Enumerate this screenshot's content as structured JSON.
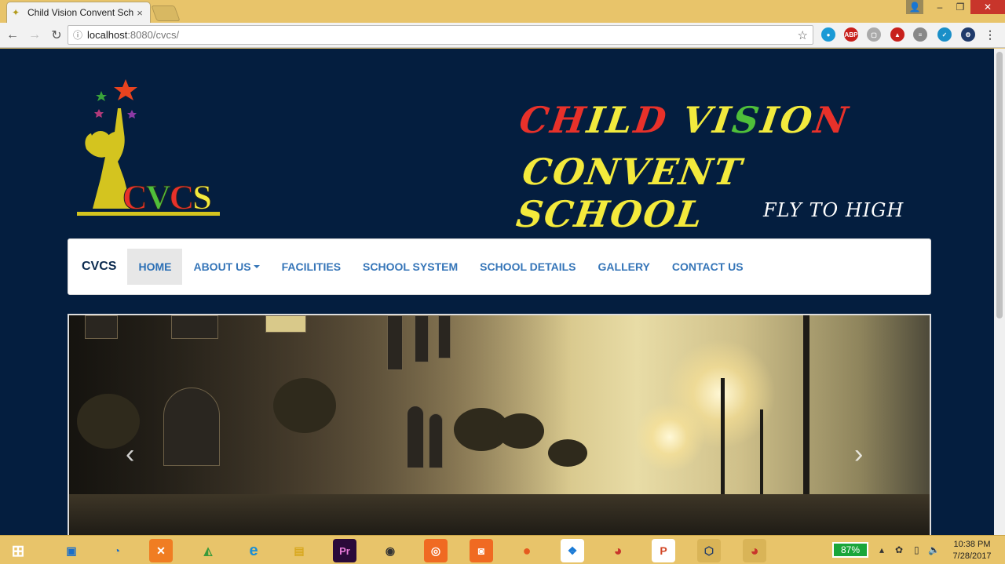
{
  "browser": {
    "tab_title": "Child Vision Convent Sch",
    "tab_close": "×",
    "url_host": "localhost",
    "url_path": ":8080/cvcs/",
    "minimize": "–",
    "restore": "❐",
    "close": "✕"
  },
  "site": {
    "logo_text": [
      "C",
      "V",
      "C",
      "S"
    ],
    "title_line1": [
      "C",
      "H",
      "I",
      "L",
      "D",
      " ",
      "V",
      "I",
      "S",
      "I",
      "O",
      "N"
    ],
    "title_line1_colors": [
      "#e8312a",
      "#e8312a",
      "#f2ea3d",
      "#f2ea3d",
      "#e8312a",
      "#fff",
      "#f2ea3d",
      "#f2ea3d",
      "#4fbf3a",
      "#f2ea3d",
      "#f2ea3d",
      "#e8312a"
    ],
    "title_line2": "CONVENT SCHOOL",
    "tagline": "FLY TO HIGH",
    "brand": "CVCS",
    "nav": [
      "HOME",
      "ABOUT US",
      "FACILITIES",
      "SCHOOL SYSTEM",
      "SCHOOL DETAILS",
      "GALLERY",
      "CONTACT US"
    ],
    "active_nav": "HOME",
    "carousel_prev": "‹",
    "carousel_next": "›"
  },
  "taskbar": {
    "battery": "87%",
    "time": "10:38 PM",
    "date": "7/28/2017"
  },
  "colors": {
    "page_bg": "#041e3f",
    "nav_link": "#3575b8",
    "accent_yellow": "#f2ea3d",
    "accent_red": "#e8312a",
    "accent_green": "#4fbf3a"
  }
}
